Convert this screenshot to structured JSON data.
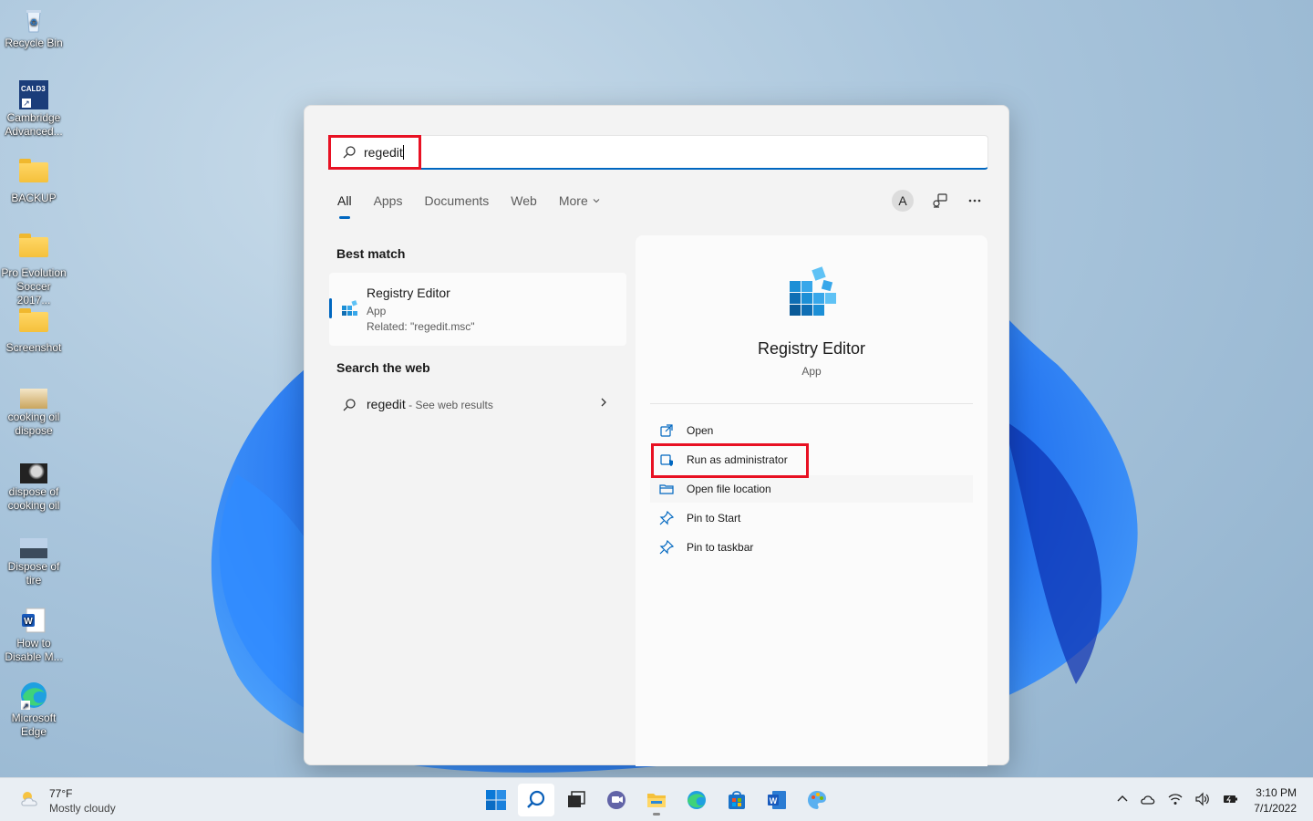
{
  "desktop": {
    "icons": [
      {
        "label": "Recycle Bin",
        "icon": "recycle-bin-icon"
      },
      {
        "label": "Cambridge Advanced...",
        "icon": "cambridge-dictionary-icon"
      },
      {
        "label": "BACKUP",
        "icon": "folder-icon"
      },
      {
        "label": "Pro Evolution Soccer 2017...",
        "icon": "folder-icon"
      },
      {
        "label": "Screenshot",
        "icon": "folder-icon"
      },
      {
        "label": "cooking oil dispose",
        "icon": "image-file-icon"
      },
      {
        "label": "dispose of cooking oil",
        "icon": "image-file-icon"
      },
      {
        "label": "Dispose of tire",
        "icon": "image-file-icon"
      },
      {
        "label": "How to Disable M...",
        "icon": "word-document-icon"
      },
      {
        "label": "Microsoft Edge",
        "icon": "edge-icon"
      }
    ],
    "cambridge_badge": "CALD3"
  },
  "search": {
    "query": "regedit"
  },
  "tabs": [
    {
      "label": "All"
    },
    {
      "label": "Apps"
    },
    {
      "label": "Documents"
    },
    {
      "label": "Web"
    },
    {
      "label": "More"
    }
  ],
  "header_right": {
    "avatar_letter": "A"
  },
  "best_match": {
    "section_title": "Best match",
    "name": "Registry Editor",
    "type": "App",
    "related": "Related: \"regedit.msc\""
  },
  "web": {
    "section_title": "Search the web",
    "query": "regedit",
    "suffix": " - See web results"
  },
  "detail": {
    "name": "Registry Editor",
    "type": "App",
    "actions": [
      {
        "label": "Open",
        "icon": "open-external-icon"
      },
      {
        "label": "Run as administrator",
        "icon": "shield-icon"
      },
      {
        "label": "Open file location",
        "icon": "folder-open-icon"
      },
      {
        "label": "Pin to Start",
        "icon": "pin-icon"
      },
      {
        "label": "Pin to taskbar",
        "icon": "pin-icon"
      }
    ]
  },
  "taskbar": {
    "weather_temp": "77°F",
    "weather_condition": "Mostly cloudy",
    "time": "3:10 PM",
    "date": "7/1/2022"
  },
  "colors": {
    "accent": "#0067c0",
    "highlight_box": "#e81123"
  }
}
